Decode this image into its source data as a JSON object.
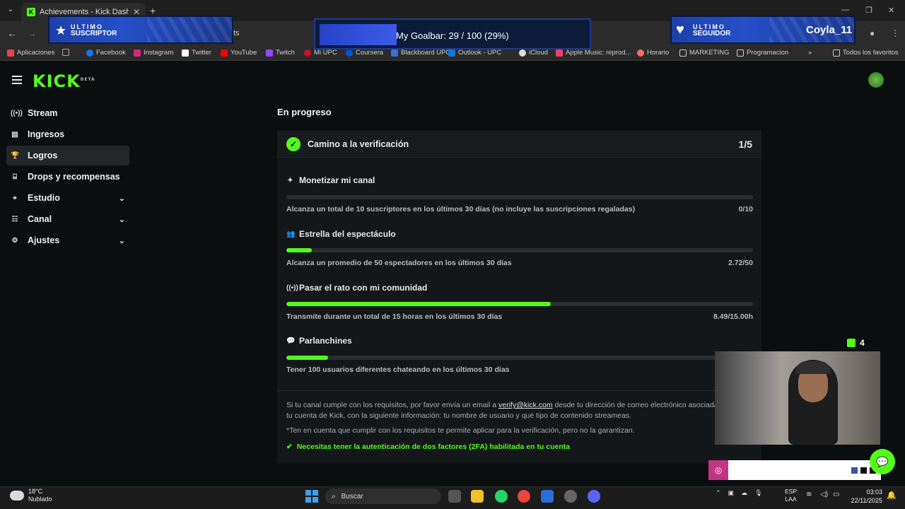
{
  "browser": {
    "tab_title": "Achievements - Kick Dashboard",
    "partial_url_text": "ts",
    "bookmarks": [
      "Aplicaciones",
      "Facebook",
      "Instagram",
      "Twitter",
      "YouTube",
      "Twitch",
      "Mi UPC",
      "Coursera",
      "Blackboard UPC",
      "Outlook - UPC",
      "iCloud",
      "Apple Music: reprod...",
      "Horario",
      "MARKETING",
      "Programacion",
      "Todos los favoritos"
    ]
  },
  "overlay": {
    "subscriber_title": "ULTIMO",
    "subscriber_sub": "SUSCRIPTOR",
    "goal_text": "My Goalbar:  29 / 100 (29%)",
    "goal_progress": 0.29,
    "follower_title": "ULTIMO",
    "follower_sub": "SEGUIDOR",
    "follower_name": "Coyla_11",
    "kick_viewers": "4"
  },
  "brand": {
    "logo": "KICK",
    "logo_badge": "BETA",
    "accent": "#53fc18"
  },
  "sidebar": {
    "items": [
      {
        "label": "Stream",
        "icon": "broadcast-icon",
        "glyph": "((•))",
        "expandable": false
      },
      {
        "label": "Ingresos",
        "icon": "chart-icon",
        "glyph": "▤",
        "expandable": false
      },
      {
        "label": "Logros",
        "icon": "trophy-icon",
        "glyph": "🏆",
        "expandable": false,
        "active": true
      },
      {
        "label": "Drops y recompensas",
        "icon": "gift-icon",
        "glyph": "⌸",
        "expandable": false
      },
      {
        "label": "Estudio",
        "icon": "studio-icon",
        "glyph": "⌖",
        "expandable": true
      },
      {
        "label": "Canal",
        "icon": "channel-icon",
        "glyph": "☷",
        "expandable": true
      },
      {
        "label": "Ajustes",
        "icon": "gear-icon",
        "glyph": "⚙",
        "expandable": true
      }
    ]
  },
  "main": {
    "section_title": "En progreso",
    "card": {
      "title": "Camino a la verificación",
      "count": "1/5",
      "goals": [
        {
          "name": "Monetizar mi canal",
          "icon": "sparkle-icon",
          "glyph": "✦",
          "desc": "Alcanza un total de 10 suscriptores en los últimos 30 días (no incluye las suscripciones regaladas)",
          "value": "0/10",
          "progress": 0.0
        },
        {
          "name": "Estrella del espectáculo",
          "icon": "users-icon",
          "glyph": "👥",
          "desc": "Alcanza un promedio de 50 espectadores en los últimos 30 días",
          "value": "2.72/50",
          "progress": 0.0544
        },
        {
          "name": "Pasar el rato con mi comunidad",
          "icon": "broadcast-icon",
          "glyph": "((•))",
          "desc": "Transmite durante un total de 15 horas en los últimos 30 días",
          "value": "8.49/15.00h",
          "progress": 0.566
        },
        {
          "name": "Parlanchines",
          "icon": "chat-icon",
          "glyph": "💬",
          "desc": "Tener 100 usuarios diferentes chateando en los últimos 30 días",
          "value": "",
          "progress": 0.09
        }
      ],
      "info_prefix": "Si tu canal cumple con los requisitos, por favor envía un email a ",
      "info_email": "verify@kick.com",
      "info_suffix": " desde tu dirección de correo electrónico asociada a tu cuenta de Kick, con la siguiente información: tu nombre de usuario y qué tipo de contenido streameas.",
      "disclaimer": "*Ten en cuenta que cumplir con los requisitos te permite aplicar para la verificación, pero no la garantizan.",
      "twofa": "Necesitas tener la autenticación de dos factores (2FA) habilitada en tu cuenta"
    }
  },
  "taskbar": {
    "weather_temp": "18°C",
    "weather_desc": "Nublado",
    "search_placeholder": "Buscar",
    "lang_top": "ESP",
    "lang_bottom": "LAA",
    "time": "03:03",
    "date": "22/11/2025"
  }
}
